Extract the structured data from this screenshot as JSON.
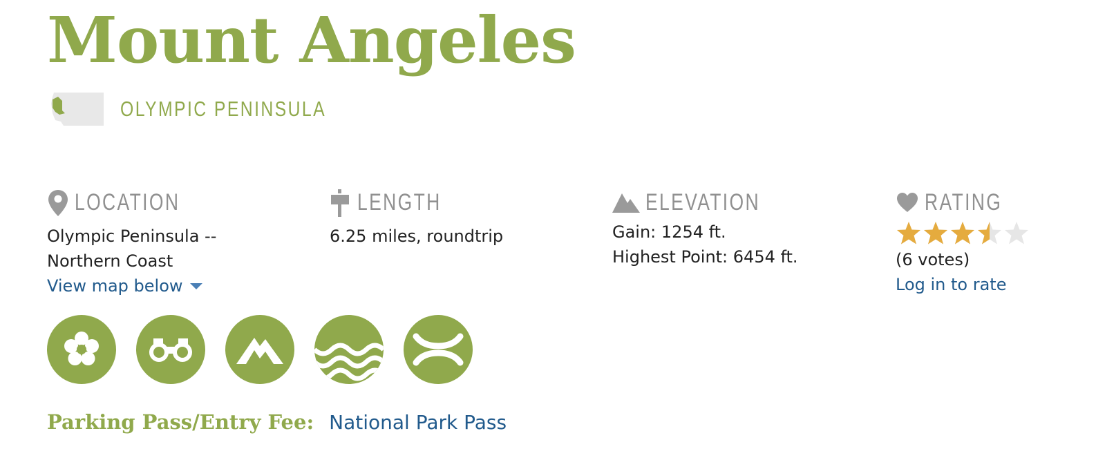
{
  "hike": {
    "name": "Mount Angeles",
    "region": "OLYMPIC PENINSULA"
  },
  "stats": {
    "location": {
      "label": "LOCATION",
      "line1": "Olympic Peninsula --",
      "line2": "Northern Coast",
      "map_link": "View map below",
      "icon": "map-pin-icon"
    },
    "length": {
      "label": "LENGTH",
      "value": "6.25 miles, roundtrip",
      "icon": "trail-sign-icon"
    },
    "elevation": {
      "label": "ELEVATION",
      "gain": "Gain: 1254 ft.",
      "highest": "Highest Point: 6454 ft.",
      "icon": "mountain-icon"
    },
    "rating": {
      "label": "RATING",
      "value": 3.5,
      "max": 5,
      "votes": "(6 votes)",
      "login_link": "Log in to rate",
      "icon": "heart-icon"
    }
  },
  "features": [
    "wildflowers-icon",
    "binoculars-icon",
    "summit-icon",
    "water-icon",
    "crossroads-icon"
  ],
  "parking": {
    "label": "Parking Pass/Entry Fee:",
    "value": "National Park Pass"
  },
  "colors": {
    "accent": "#90a94c",
    "link": "#215a8c",
    "muted": "#909090",
    "star": "#e5ab3e",
    "star_empty": "#e6e6e6"
  }
}
